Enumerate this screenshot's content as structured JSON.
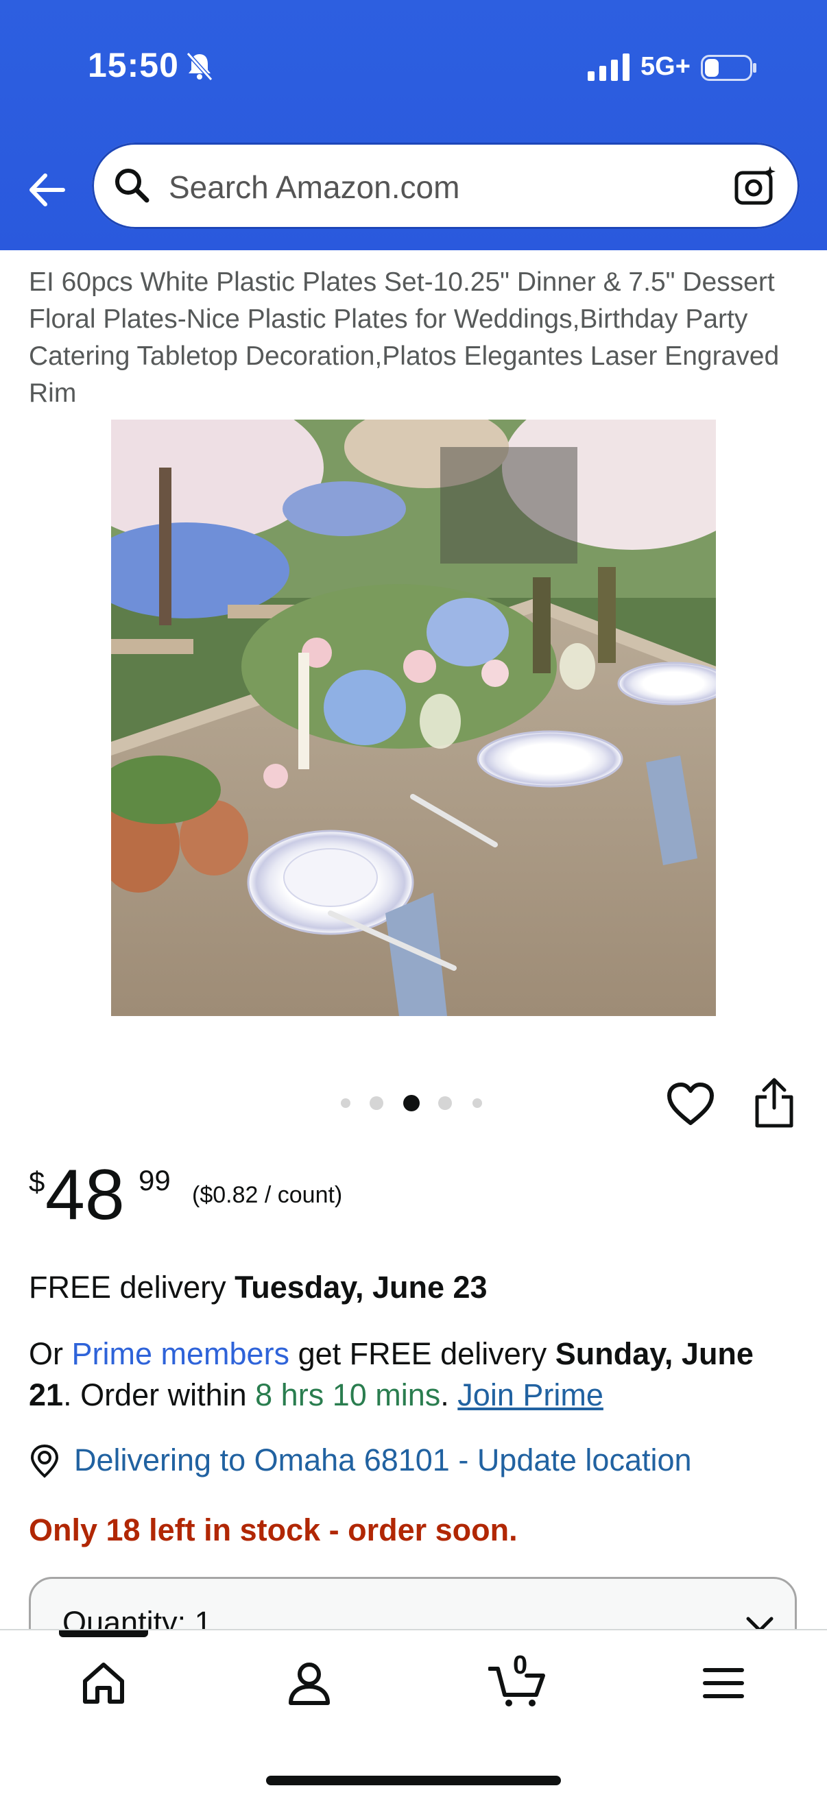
{
  "status_bar": {
    "time": "15:50",
    "network": "5G+"
  },
  "search": {
    "placeholder": "Search Amazon.com"
  },
  "product": {
    "title": "EI 60pcs White Plastic Plates Set-10.25\" Dinner & 7.5\" Dessert Floral Plates-Nice Plastic Plates for Weddings,Birthday Party Catering Tabletop Decoration,Platos Elegantes Laser Engraved Rim",
    "image_count": 5,
    "active_image": 3
  },
  "price": {
    "symbol": "$",
    "whole": "48",
    "fraction": "99",
    "unit_price": "($0.82 / count)"
  },
  "delivery": {
    "free_prefix": "FREE delivery ",
    "free_date": "Tuesday, June 23",
    "or": "Or ",
    "prime_members": "Prime members",
    "prime_mid": " get FREE delivery ",
    "prime_date": "Sunday, June 21",
    "order_within_prefix": ". Order within ",
    "countdown": "8 hrs 10 mins",
    "period": ". ",
    "join_prime": "Join Prime"
  },
  "location": {
    "text": "Delivering to Omaha 68101 - Update location"
  },
  "stock": {
    "text": "Only 18 left in stock - order soon."
  },
  "quantity": {
    "label": "Quantity: 1"
  },
  "bottom_nav": {
    "items": [
      "home-icon",
      "account-icon",
      "cart-icon",
      "menu-icon"
    ],
    "cart_count": "0"
  },
  "colors": {
    "header_blue": "#2d5fe0",
    "link_blue": "#2162a1",
    "stock_red": "#b12704",
    "countdown_green": "#2a7d4f"
  }
}
